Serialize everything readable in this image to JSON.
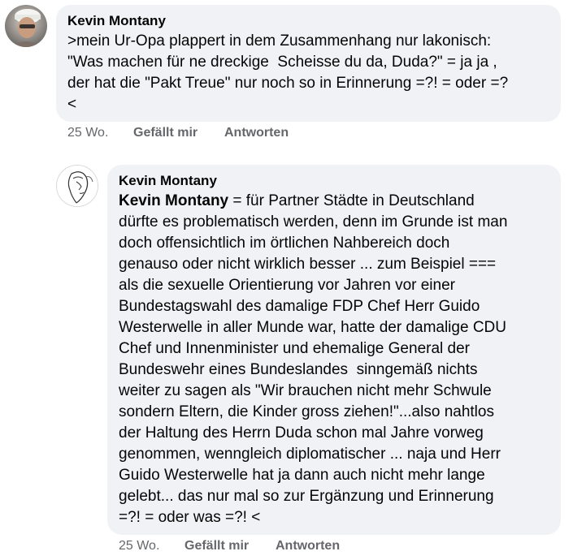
{
  "comments": [
    {
      "author": "Kevin Montany",
      "lines": [
        ">mein Ur-Opa plappert in dem Zusammenhang nur lakonisch:",
        "\"Was machen für ne dreckige  Scheisse du da, Duda?\" = ja ja ,",
        "der hat die \"Pakt Treue\" nur noch so in Erinnerung =?! = oder =?",
        "<"
      ],
      "time": "25 Wo.",
      "like_label": "Gefällt mir",
      "reply_label": "Antworten"
    },
    {
      "author": "Kevin Montany",
      "mention": "Kevin Montany",
      "first_line_rest": " = für Partner Städte in Deutschland",
      "lines": [
        "dürfte es problematisch werden, denn im Grunde ist man",
        "doch offensichtlich im örtlichen Nahbereich doch",
        "genauso oder nicht wirklich besser ... zum Beispiel ===",
        "als die sexuelle Orientierung vor Jahren vor einer",
        "Bundestagswahl des damalige FDP Chef Herr Guido",
        "Westerwelle in aller Munde war, hatte der damalige CDU",
        "Chef und Innenminister und ehemalige General der",
        "Bundeswehr eines Bundeslandes  sinngemäß nichts",
        "weiter zu sagen als \"Wir brauchen nicht mehr Schwule",
        "sondern Eltern, die Kinder gross ziehen!\"...also nahtlos",
        "der Haltung des Herrn Duda schon mal Jahre vorweg",
        "genommen, wenngleich diplomatischer ... naja und Herr",
        "Guido Westerwelle hat ja dann auch nicht mehr lange",
        "gelebt... das nur mal so zur Ergänzung und Erinnerung",
        "=?! = oder was =?! <"
      ],
      "time": "25 Wo.",
      "like_label": "Gefällt mir",
      "reply_label": "Antworten"
    }
  ],
  "colors": {
    "bubble": "#f0f2f5",
    "text": "#050505",
    "meta": "#65676b"
  },
  "icons": {
    "avatar1": "profile-photo-avatar",
    "avatar2": "sketch-face-avatar"
  }
}
